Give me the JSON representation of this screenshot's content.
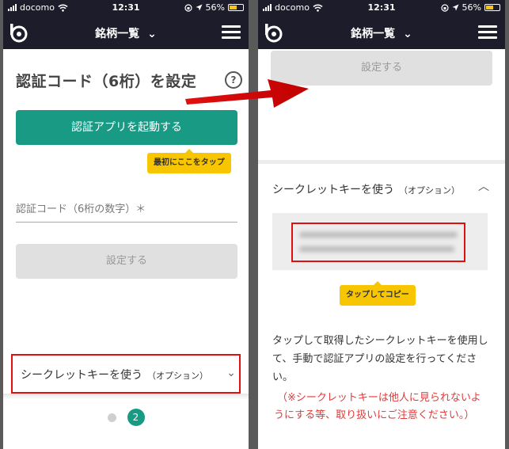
{
  "status": {
    "carrier": "docomo",
    "time": "12:31",
    "battery": "56%"
  },
  "nav": {
    "title": "銘柄一覧"
  },
  "left": {
    "heading": "認証コード（6桁）を設定",
    "help": "?",
    "launch_button": "認証アプリを起動する",
    "tooltip_first": "最初にここをタップ",
    "code_placeholder": "認証コード（6桁の数字）＊",
    "set_button": "設定する",
    "secret_toggle": "シークレットキーを使う",
    "secret_toggle_sub": "（オプション）",
    "pager": {
      "current": "2"
    }
  },
  "right": {
    "set_button": "設定する",
    "secret_toggle": "シークレットキーを使う",
    "secret_toggle_sub": "（オプション）",
    "tooltip_copy": "タップしてコピー",
    "instructions": "タップして取得したシークレットキーを使用して、手動で認証アプリの設定を行ってください。",
    "warning": "（※シークレットキーは他人に見られないようにする等、取り扱いにご注意ください。）"
  },
  "colors": {
    "accent": "#199a84",
    "navbar": "#1c1c2a",
    "tooltip": "#f7c600",
    "highlight": "#e01010",
    "warning_text": "#e03a3a"
  },
  "icons": [
    "wifi-icon",
    "signal-icon",
    "battery-icon",
    "logo-icon",
    "chevron-down-icon",
    "hamburger-icon",
    "help-icon",
    "chevron-up-icon",
    "arrow-icon"
  ]
}
